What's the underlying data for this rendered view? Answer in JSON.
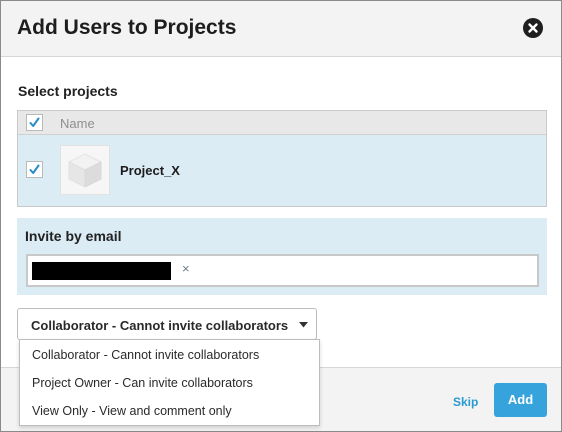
{
  "dialog": {
    "title": "Add Users to Projects"
  },
  "projects": {
    "label": "Select projects",
    "column_name": "Name",
    "rows": [
      {
        "name": "Project_X",
        "checked": true
      }
    ],
    "header_checked": true
  },
  "invite": {
    "label": "Invite by email",
    "chip_remove": "×"
  },
  "role_select": {
    "selected": "Collaborator - Cannot invite collaborators",
    "options": [
      "Collaborator - Cannot invite collaborators",
      "Project Owner - Can invite collaborators",
      "View Only - View and comment only"
    ]
  },
  "footer": {
    "skip_label": "Skip",
    "add_label": "Add"
  },
  "colors": {
    "accent": "#36a3dc",
    "link": "#2a9ad0",
    "selection": "#dcecf5"
  },
  "icons": {
    "close": "close-icon",
    "check": "checkmark-icon",
    "project": "cube-icon",
    "dropdown": "caret-down-icon"
  }
}
